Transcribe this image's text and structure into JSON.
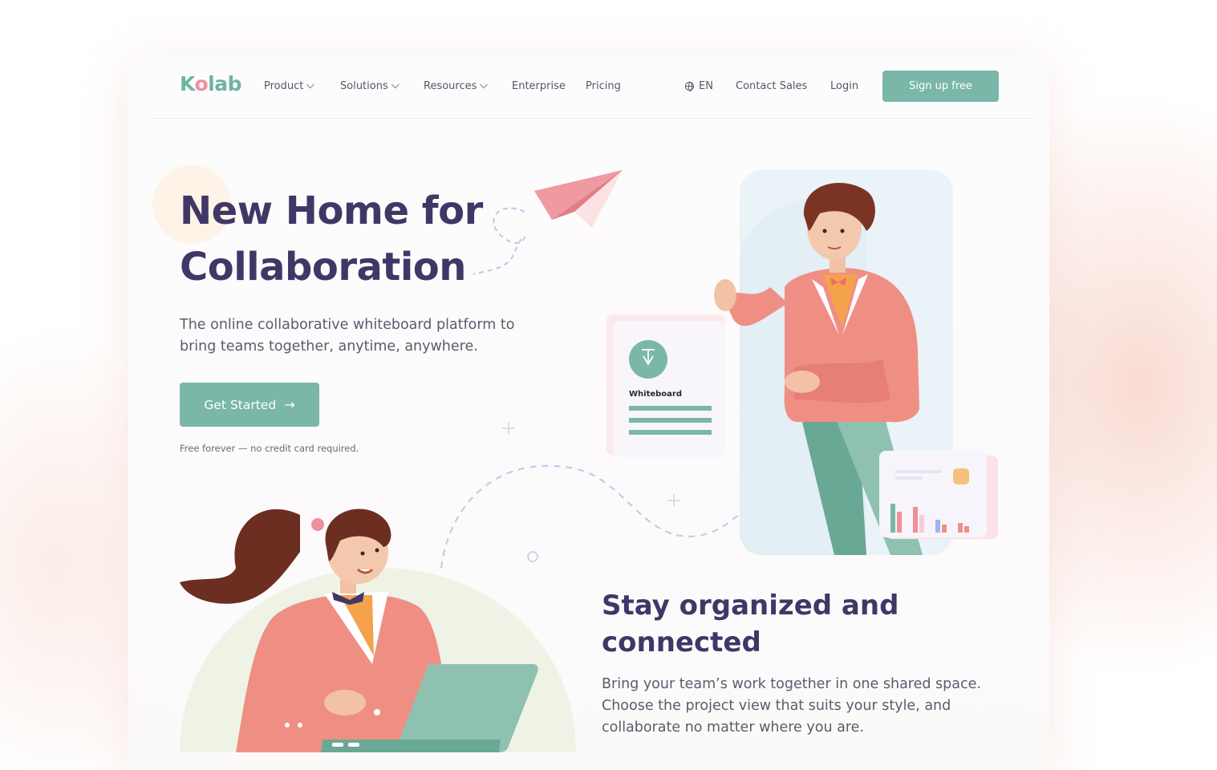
{
  "brand": {
    "logo_text_a": "K",
    "logo_text_o": "o",
    "logo_text_b": "lab"
  },
  "nav": {
    "items": [
      {
        "label": "Product",
        "has_dropdown": true
      },
      {
        "label": "Solutions",
        "has_dropdown": true
      },
      {
        "label": "Resources",
        "has_dropdown": true
      },
      {
        "label": "Enterprise",
        "has_dropdown": false
      },
      {
        "label": "Pricing",
        "has_dropdown": false
      }
    ],
    "language": "EN",
    "contact_sales": "Contact Sales",
    "login": "Login",
    "signup": "Sign up free"
  },
  "hero": {
    "title_line1": "New Home for",
    "title_line2": "Collaboration",
    "subtitle_line1": "The online collaborative whiteboard platform to",
    "subtitle_line2": "bring teams together, anytime, anywhere.",
    "cta_label": "Get Started",
    "note": "Free forever — no credit card required."
  },
  "whiteboard_card": {
    "label": "Whiteboard"
  },
  "section": {
    "title_line1": "Stay organized and",
    "title_line2": "connected",
    "body_line1": "Bring your team’s work together in one shared space.",
    "body_line2": "Choose the project view that suits your style, and",
    "body_line3": "collaborate no matter where you are."
  },
  "colors": {
    "accent": "#7ab7a9",
    "heading": "#403767",
    "body": "#5f5a6b",
    "coral": "#ef8f84",
    "pink": "#ef8f9b"
  }
}
